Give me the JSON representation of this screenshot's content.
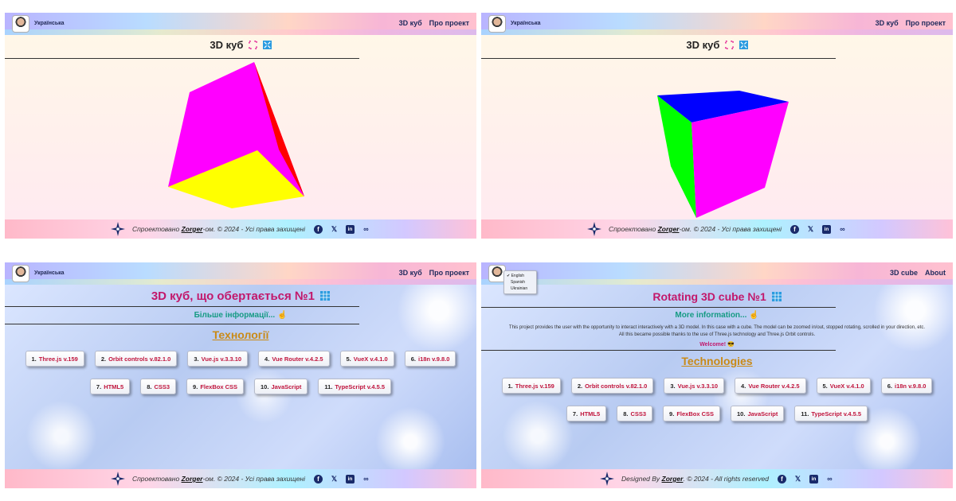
{
  "panels": [
    {
      "lang_label": "Українська",
      "nav": [
        "3D куб",
        "Про проект"
      ],
      "title": "3D куб",
      "footer": {
        "prefix": "Спроектовано ",
        "brand": "Zorger",
        "suffix": "-ом. © 2024 - Усі права захищені"
      }
    },
    {
      "lang_label": "Українська",
      "nav": [
        "3D куб",
        "Про проект"
      ],
      "title": "3D куб",
      "footer": {
        "prefix": "Спроектовано ",
        "brand": "Zorger",
        "suffix": "-ом. © 2024 - Усі права захищені"
      }
    },
    {
      "lang_label": "Українська",
      "nav": [
        "3D куб",
        "Про проект"
      ],
      "title": "3D куб, що обертається №1",
      "more_info": "Більше інформації...",
      "tech_title": "Технології",
      "techs": [
        {
          "num": "1.",
          "name": "Three.js v.159"
        },
        {
          "num": "2.",
          "name": "Orbit controls v.82.1.0"
        },
        {
          "num": "3.",
          "name": "Vue.js v.3.3.10"
        },
        {
          "num": "4.",
          "name": "Vue Router v.4.2.5"
        },
        {
          "num": "5.",
          "name": "VueX v.4.1.0"
        },
        {
          "num": "6.",
          "name": "i18n v.9.8.0"
        },
        {
          "num": "7.",
          "name": "HTML5"
        },
        {
          "num": "8.",
          "name": "CSS3"
        },
        {
          "num": "9.",
          "name": "FlexBox CSS"
        },
        {
          "num": "10.",
          "name": "JavaScript"
        },
        {
          "num": "11.",
          "name": "TypeScript v.4.5.5"
        }
      ],
      "footer": {
        "prefix": "Спроектовано ",
        "brand": "Zorger",
        "suffix": "-ом. © 2024 - Усі права захищені"
      }
    },
    {
      "lang_options": [
        "English",
        "Spanish",
        "Ukrainian"
      ],
      "lang_selected": "English",
      "nav": [
        "3D cube",
        "About"
      ],
      "title": "Rotating 3D cube №1",
      "more_info": "More information...",
      "description_1": "This project provides the user with the opportunity to interact interactively with a 3D model. In this case with a cube. The model can be zoomed in/out, stopped rotating, scrolled in your direction, etc.",
      "description_2": "All this became possible thanks to the use of Three.js technology and Three.js Orbit controls.",
      "welcome": "Welcome! 😎",
      "tech_title": "Technologies",
      "techs": [
        {
          "num": "1.",
          "name": "Three.js v.159"
        },
        {
          "num": "2.",
          "name": "Orbit controls v.82.1.0"
        },
        {
          "num": "3.",
          "name": "Vue.js v.3.3.10"
        },
        {
          "num": "4.",
          "name": "Vue Router v.4.2.5"
        },
        {
          "num": "5.",
          "name": "VueX v.4.1.0"
        },
        {
          "num": "6.",
          "name": "i18n v.9.8.0"
        },
        {
          "num": "7.",
          "name": "HTML5"
        },
        {
          "num": "8.",
          "name": "CSS3"
        },
        {
          "num": "9.",
          "name": "FlexBox CSS"
        },
        {
          "num": "10.",
          "name": "JavaScript"
        },
        {
          "num": "11.",
          "name": "TypeScript v.4.5.5"
        }
      ],
      "footer": {
        "prefix": "Designed By ",
        "brand": "Zorger",
        "suffix": ". © 2024 - All rights reserved"
      }
    }
  ],
  "icons": {
    "fullscreen": "fullscreen-icon",
    "exit_fullscreen": "expand-arrows-icon",
    "grid": "grid-icon",
    "pointer": "pointing-hand-icon",
    "social": [
      "facebook-icon",
      "x-icon",
      "linkedin-icon",
      "link-icon"
    ]
  },
  "colors": {
    "title_pink": "#c2186b",
    "teal": "#169b84",
    "gold": "#c98a17",
    "tech_red": "#c0143c",
    "nav_navy": "#1f2a5c",
    "cube1": {
      "left": "#ff00ff",
      "right": "#ff0000",
      "bottom": "#ffff00"
    },
    "cube2": {
      "top": "#0000ff",
      "left": "#00ff00",
      "right": "#ff00ff"
    }
  }
}
